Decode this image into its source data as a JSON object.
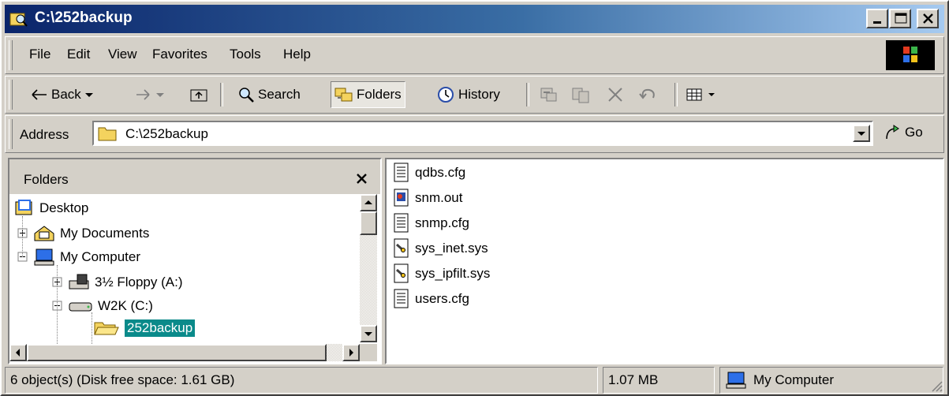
{
  "window": {
    "title": "C:\\252backup"
  },
  "menu": [
    "File",
    "Edit",
    "View",
    "Favorites",
    "Tools",
    "Help"
  ],
  "toolbar": {
    "back": "Back",
    "search": "Search",
    "folders": "Folders",
    "history": "History"
  },
  "address": {
    "label": "Address",
    "value": "C:\\252backup",
    "go": "Go"
  },
  "folders_pane": {
    "title": "Folders",
    "tree": [
      "Desktop",
      "My Documents",
      "My Computer",
      "3½ Floppy (A:)",
      "W2K (C:)",
      "252backup"
    ]
  },
  "files": [
    {
      "name": "qdbs.cfg",
      "icon": "text-file-icon"
    },
    {
      "name": "snm.out",
      "icon": "app-file-icon"
    },
    {
      "name": "snmp.cfg",
      "icon": "text-file-icon"
    },
    {
      "name": "sys_inet.sys",
      "icon": "system-file-icon"
    },
    {
      "name": "sys_ipfilt.sys",
      "icon": "system-file-icon"
    },
    {
      "name": "users.cfg",
      "icon": "text-file-icon"
    }
  ],
  "status": {
    "objects": "6 object(s) (Disk free space: 1.61 GB)",
    "size": "1.07 MB",
    "zone": "My Computer"
  }
}
